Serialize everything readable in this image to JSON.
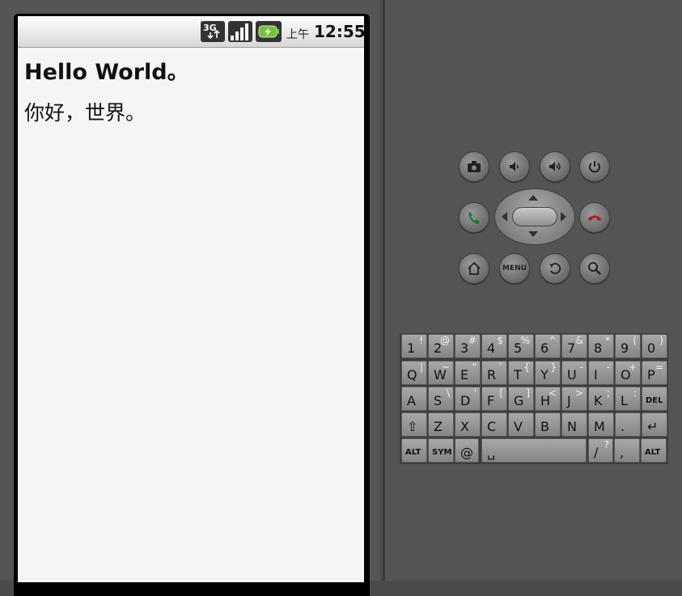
{
  "status_bar": {
    "network_label": "3G",
    "am_pm": "上午",
    "time": "12:55"
  },
  "app": {
    "line1": "Hello World。",
    "line2": "你好，世界。"
  },
  "controls": {
    "camera": "camera-icon",
    "vol_down": "volume-down-icon",
    "vol_up": "volume-up-icon",
    "power": "power-icon",
    "call": "call-icon",
    "end_call": "end-call-icon",
    "home": "home-icon",
    "menu_label": "MENU",
    "back": "back-icon",
    "search": "search-icon"
  },
  "keyboard": {
    "row1": [
      [
        "1",
        "!"
      ],
      [
        "2",
        "@"
      ],
      [
        "3",
        "#"
      ],
      [
        "4",
        "$"
      ],
      [
        "5",
        "%"
      ],
      [
        "6",
        "^"
      ],
      [
        "7",
        "&"
      ],
      [
        "8",
        "*"
      ],
      [
        "9",
        "("
      ],
      [
        "0",
        ")"
      ]
    ],
    "row2": [
      [
        "Q",
        "|"
      ],
      [
        "W",
        "~"
      ],
      [
        "E",
        "\""
      ],
      [
        "R",
        "`"
      ],
      [
        "T",
        "{"
      ],
      [
        "Y",
        "}"
      ],
      [
        "U",
        "-"
      ],
      [
        "I",
        "-"
      ],
      [
        "O",
        "+"
      ],
      [
        "P",
        "="
      ]
    ],
    "row3": [
      [
        "A",
        ""
      ],
      [
        "S",
        "\\"
      ],
      [
        "D",
        "'"
      ],
      [
        "F",
        "["
      ],
      [
        "G",
        "]"
      ],
      [
        "H",
        "<"
      ],
      [
        "J",
        ">"
      ],
      [
        "K",
        ";"
      ],
      [
        "L",
        ":"
      ]
    ],
    "row3_del": "DEL",
    "row4": [
      [
        "Z",
        ""
      ],
      [
        "X",
        ""
      ],
      [
        "C",
        ""
      ],
      [
        "V",
        ""
      ],
      [
        "B",
        ""
      ],
      [
        "N",
        ""
      ],
      [
        "M",
        ""
      ],
      [
        ".",
        ""
      ]
    ],
    "alt_label": "ALT",
    "sym_label": "SYM",
    "at_label": "@",
    "slash_main": "/",
    "slash_alt": "?",
    "comma": ","
  }
}
